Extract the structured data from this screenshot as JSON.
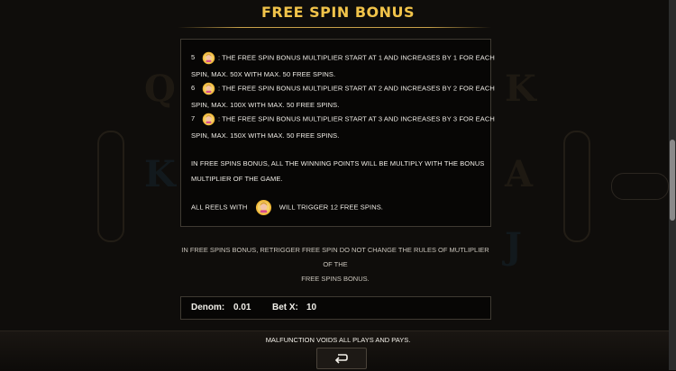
{
  "page": {
    "title": "FREE SPIN BONUS"
  },
  "rules": [
    {
      "count": "5",
      "icon": "scatter-bust-icon",
      "line1": ": THE FREE SPIN BONUS MULTIPLIER START AT 1 AND INCREASES BY 1 FOR EACH",
      "line2": "SPIN, MAX. 50X WITH MAX. 50 FREE SPINS."
    },
    {
      "count": "6",
      "icon": "scatter-bust-icon",
      "line1": ": THE FREE SPIN BONUS MULTIPLIER START AT 2 AND INCREASES BY 2 FOR EACH",
      "line2": "SPIN, MAX. 100X WITH MAX. 50 FREE SPINS."
    },
    {
      "count": "7",
      "icon": "scatter-bust-icon",
      "line1": ": THE FREE SPIN BONUS MULTIPLIER START AT 3 AND INCREASES BY 3 FOR EACH",
      "line2": "SPIN, MAX. 150X WITH MAX. 50 FREE SPINS."
    }
  ],
  "bonus_text": {
    "line1": "IN FREE SPINS BONUS, ALL THE WINNING POINTS WILL BE MULTIPLY WITH THE BONUS",
    "line2": "MULTIPLIER OF THE GAME."
  },
  "trigger": {
    "prefix": "ALL REELS WITH",
    "icon": "scatter-bust-icon",
    "suffix": "WILL TRIGGER 12 FREE SPINS."
  },
  "retrigger_note": {
    "line1": "IN FREE SPINS BONUS, RETRIGGER FREE SPIN DO NOT CHANGE THE RULES OF MUTLIPLIER OF THE",
    "line2": "FREE SPINS BONUS."
  },
  "denom": {
    "label": "Denom:",
    "value": "0.01"
  },
  "bet": {
    "label": "Bet X:",
    "value": "10"
  },
  "footer": {
    "malfunction_text": "MALFUNCTION VOIDS ALL PLAYS AND PAYS.",
    "back_icon": "return-arrow-icon"
  },
  "colors": {
    "title": "#f1c34a",
    "panel_border": "#3f3a32",
    "background": "#0f0d0b"
  }
}
